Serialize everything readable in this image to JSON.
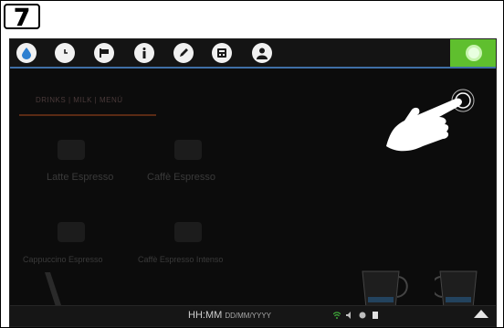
{
  "step": {
    "number": "7"
  },
  "topbar": {
    "icons": [
      "water-drop-icon",
      "clock-icon",
      "flag-icon",
      "info-icon",
      "pencil-icon",
      "calculator-icon",
      "user-icon"
    ],
    "settings_icon": "gear-icon",
    "accent_color": "#5fbf2e",
    "underline_color": "#3f6fa6"
  },
  "background_menu": {
    "tab_label": "DRINKS | MILK | MENÚ",
    "items": [
      {
        "label": "Latte Espresso"
      },
      {
        "label": "Caffè Espresso"
      },
      {
        "label": "Cappuccino Espresso"
      },
      {
        "label": "Caffè Espresso Intenso"
      }
    ]
  },
  "statusbar": {
    "time": "HH:MM",
    "date": "DD/MM/YYYY",
    "icons": [
      "wifi-icon",
      "volume-icon",
      "location-icon",
      "card-icon"
    ],
    "arrow_icon": "chevron-up-icon"
  },
  "overlay": {
    "gesture_icon": "tap-hand-icon"
  }
}
